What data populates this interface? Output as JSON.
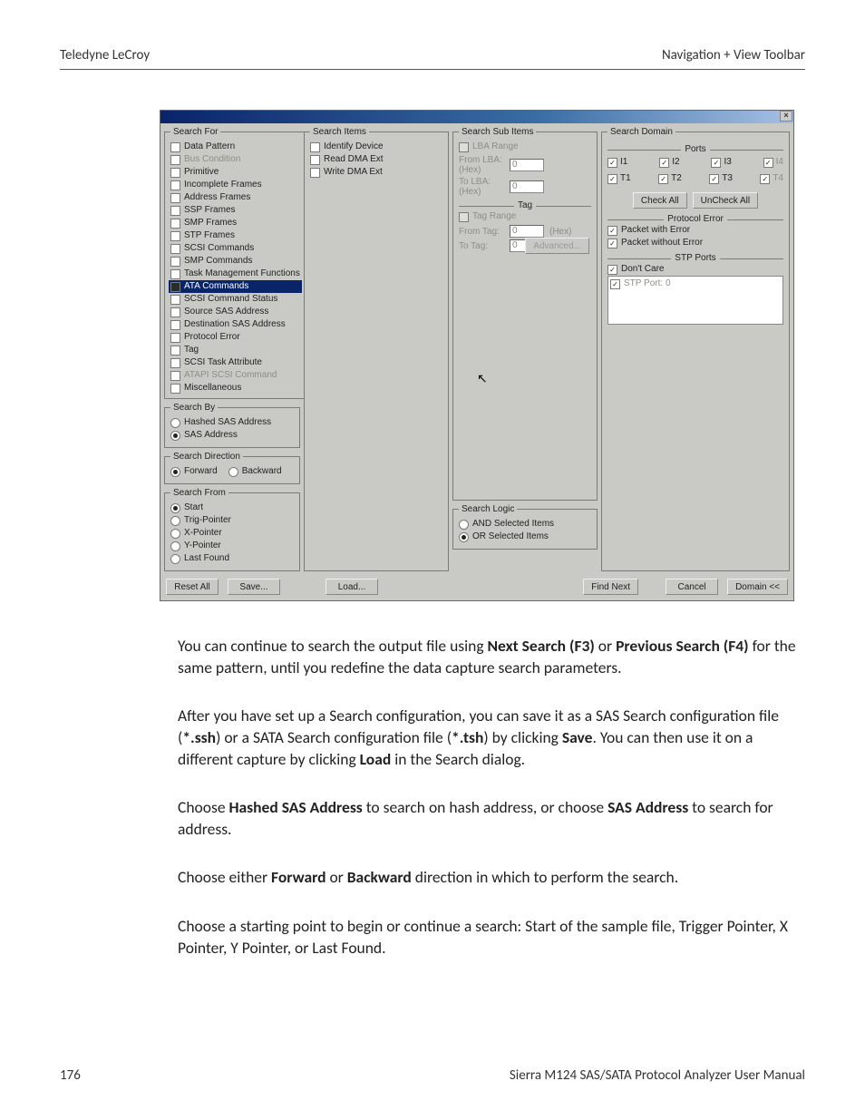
{
  "header": {
    "left": "Teledyne LeCroy",
    "right": "Navigation + View Toolbar"
  },
  "footer": {
    "page": "176",
    "manual": "Sierra M124 SAS/SATA Protocol Analyzer User Manual"
  },
  "prose": {
    "p1_a": "You can continue to search the output file using ",
    "p1_b": "Next Search (F3)",
    "p1_c": " or ",
    "p1_d": "Previous Search (F4)",
    "p1_e": " for the same pattern, until you redefine the data capture search parameters.",
    "p2_a": "After you have set up a Search configuration, you can save it as a SAS Search configuration file (",
    "p2_b": "*.ssh",
    "p2_c": ") or a SATA Search configuration file (",
    "p2_d": "*.tsh",
    "p2_e": ") by clicking ",
    "p2_f": "Save",
    "p2_g": ". You can then use it on a different capture by clicking ",
    "p2_h": "Load",
    "p2_i": " in the Search dialog.",
    "p3_a": "Choose ",
    "p3_b": "Hashed SAS Address",
    "p3_c": " to search on hash address, or choose ",
    "p3_d": "SAS Address",
    "p3_e": " to search for address.",
    "p4_a": "Choose either ",
    "p4_b": "Forward",
    "p4_c": " or ",
    "p4_d": "Backward",
    "p4_e": " direction in which to perform the search.",
    "p5": "Choose a starting point to begin or continue a search: Start of the sample file, Trigger Pointer, X Pointer, Y Pointer, or Last Found."
  },
  "dialog": {
    "search_for": {
      "legend": "Search For",
      "items": [
        {
          "label": "Data Pattern",
          "sel": false
        },
        {
          "label": "Bus Condition",
          "sel": false
        },
        {
          "label": "Primitive",
          "sel": false
        },
        {
          "label": "Incomplete Frames",
          "sel": false
        },
        {
          "label": "Address Frames",
          "sel": false
        },
        {
          "label": "SSP Frames",
          "sel": false
        },
        {
          "label": "SMP Frames",
          "sel": false
        },
        {
          "label": "STP Frames",
          "sel": false
        },
        {
          "label": "SCSI Commands",
          "sel": false
        },
        {
          "label": "SMP Commands",
          "sel": false
        },
        {
          "label": "Task Management Functions",
          "sel": false
        },
        {
          "label": "ATA Commands",
          "sel": true
        },
        {
          "label": "SCSI Command Status",
          "sel": false
        },
        {
          "label": "Source SAS Address",
          "sel": false
        },
        {
          "label": "Destination SAS Address",
          "sel": false
        },
        {
          "label": "Protocol Error",
          "sel": false
        },
        {
          "label": "Tag",
          "sel": false
        },
        {
          "label": "SCSI Task Attribute",
          "sel": false
        },
        {
          "label": "ATAPI SCSI Command",
          "sel": false
        },
        {
          "label": "Miscellaneous",
          "sel": false
        }
      ]
    },
    "search_by": {
      "legend": "Search By",
      "hashed": "Hashed SAS Address",
      "sas": "SAS Address"
    },
    "search_direction": {
      "legend": "Search Direction",
      "fwd": "Forward",
      "bwd": "Backward"
    },
    "search_from": {
      "legend": "Search From",
      "opts": [
        "Start",
        "Trig-Pointer",
        "X-Pointer",
        "Y-Pointer",
        "Last Found"
      ]
    },
    "search_items": {
      "legend": "Search Items",
      "items": [
        "Identify Device",
        "Read DMA Ext",
        "Write DMA Ext"
      ]
    },
    "sub_items": {
      "legend": "Search Sub Items",
      "lba_range": "LBA Range",
      "from_lba": "From LBA: (Hex)",
      "to_lba": "To LBA: (Hex)",
      "tag_title": "Tag",
      "tag_range": "Tag Range",
      "from_tag": "From Tag:",
      "to_tag": "To Tag:",
      "hex": "(Hex)",
      "zero": "0",
      "advanced": "Advanced..."
    },
    "search_logic": {
      "legend": "Search Logic",
      "and": "AND Selected Items",
      "or": "OR Selected Items"
    },
    "domain": {
      "legend": "Search Domain",
      "ports_title": "Ports",
      "row1": [
        "I1",
        "I2",
        "I3",
        "I4"
      ],
      "row2": [
        "T1",
        "T2",
        "T3",
        "T4"
      ],
      "check_all": "Check All",
      "uncheck_all": "UnCheck All",
      "proto_title": "Protocol Error",
      "perr": "Packet with Error",
      "pnoerr": "Packet without Error",
      "stp_title": "STP Ports",
      "dont_care": "Don't Care",
      "stp_port0": "STP Port: 0"
    },
    "buttons": {
      "reset": "Reset All",
      "save": "Save...",
      "load": "Load...",
      "find": "Find Next",
      "cancel": "Cancel",
      "domain": "Domain <<"
    }
  }
}
